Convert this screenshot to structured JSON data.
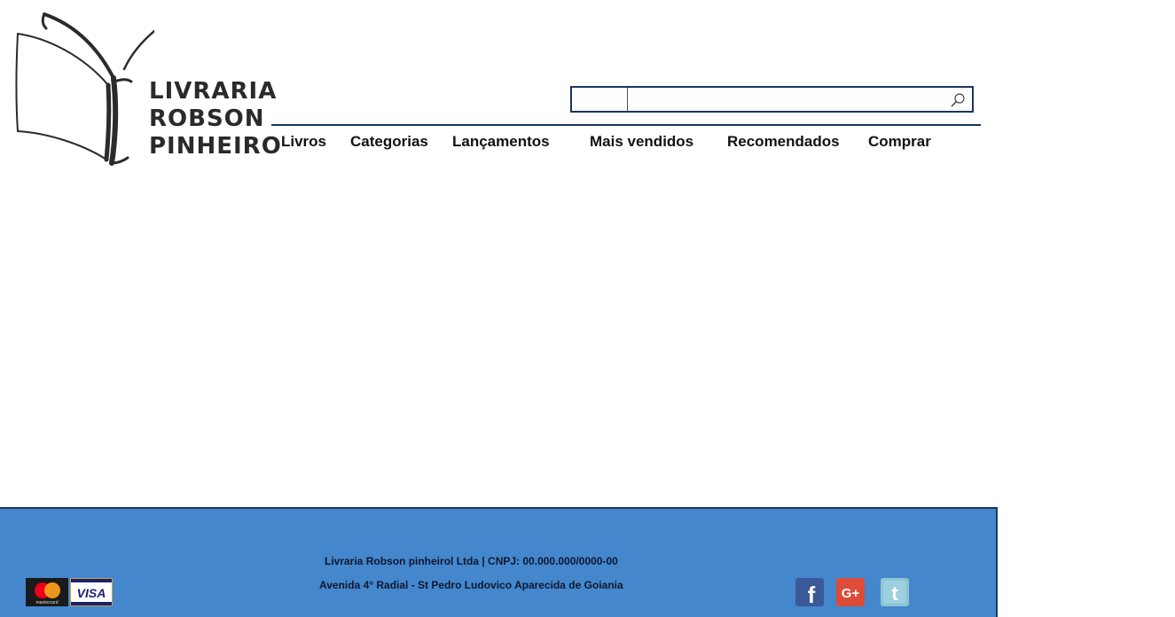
{
  "logo": {
    "line1": "LIVRARIA",
    "line2": "ROBSON",
    "line3": "PINHEIRO"
  },
  "search": {
    "value": "",
    "button_icon": "search-icon"
  },
  "nav": {
    "items": [
      "Livros",
      "Categorias",
      "Lançamentos",
      "Mais vendidos",
      "Recomendados",
      "Comprar"
    ]
  },
  "footer": {
    "company_line": "Livraria Robson pinheirol Ltda | CNPJ: 00.000.000/0000-00",
    "address_line": "Avenida 4° Radial - St Pedro Ludovico Aparecida de Goiania",
    "payment_icons": [
      "mastercard-icon",
      "visa-icon"
    ],
    "visa_label": "VISA",
    "mastercard_label": "mastercard",
    "social_icons": [
      "facebook-icon",
      "google-plus-icon",
      "twitter-icon"
    ],
    "google_plus_label": "G+",
    "facebook_label": "f",
    "twitter_label": "t"
  },
  "colors": {
    "brand_navy": "#1d3462",
    "footer_blue": "#4487cc",
    "facebook": "#3b5998",
    "google_plus": "#dd4b39",
    "twitter": "#8fc4d4"
  }
}
